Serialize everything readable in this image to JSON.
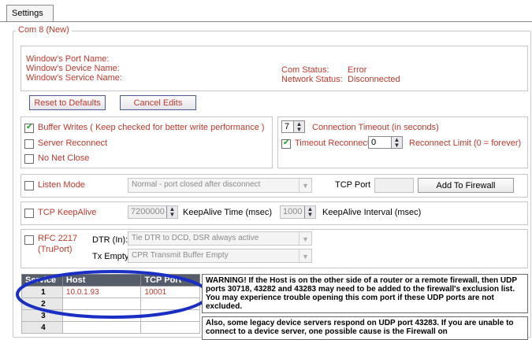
{
  "tabs": {
    "settings": "Settings"
  },
  "group": {
    "title": "Com 8 (New)"
  },
  "info": {
    "port_name_label": "Window's Port Name:",
    "device_name_label": "Window's Device Name:",
    "service_name_label": "Window's Service Name:",
    "com_status_label": "Com Status:",
    "com_status_value": "Error",
    "network_status_label": "Network Status:",
    "network_status_value": "Disconnected"
  },
  "buttons": {
    "reset": "Reset to Defaults",
    "cancel": "Cancel Edits",
    "add_firewall": "Add To Firewall"
  },
  "options": {
    "buffer_writes": "Buffer Writes   ( Keep checked for better write performance )",
    "server_reconnect": "Server Reconnect",
    "no_net_close": "No Net Close",
    "buffer_writes_checked": true,
    "server_reconnect_checked": false,
    "no_net_close_checked": false
  },
  "timeout": {
    "connection_value": "7",
    "connection_label": "Connection Timeout (in seconds)",
    "reconnect_label": "Timeout Reconnect",
    "reconnect_checked": true,
    "reconnect_limit_value": "0",
    "reconnect_limit_label": "Reconnect Limit (0 = forever)"
  },
  "listen": {
    "label": "Listen Mode",
    "checked": false,
    "mode_value": "Normal - port closed after disconnect",
    "tcp_port_label": "TCP Port",
    "tcp_port_value": ""
  },
  "keepalive": {
    "label": "TCP KeepAlive",
    "checked": false,
    "time_value": "7200000",
    "time_label": "KeepAlive Time (msec)",
    "interval_value": "1000",
    "interval_label": "KeepAlive Interval (msec)"
  },
  "rfc": {
    "label_line1": "RFC 2217",
    "label_line2": "(TruPort)",
    "checked": false,
    "dtr_label": "DTR (In):",
    "dtr_value": "Tie DTR to DCD, DSR always active",
    "tx_label": "Tx Empty:",
    "tx_value": "CPR Transmit Buffer Empty"
  },
  "table": {
    "headers": [
      "Service",
      "Host",
      "TCP Port"
    ],
    "rows": [
      {
        "num": "1",
        "host": "10.0.1.93",
        "port": "10001"
      },
      {
        "num": "2",
        "host": "",
        "port": ""
      },
      {
        "num": "3",
        "host": "",
        "port": ""
      },
      {
        "num": "4",
        "host": "",
        "port": ""
      }
    ]
  },
  "warnings": {
    "firewall": "WARNING!  If the Host is on the other side of a router or a remote firewall, then UDP ports 30718, 43282 and 43283 may need to be added to the firewall's exclusion list.  You may experience trouble opening this com port if these UDP ports are not excluded.",
    "legacy": "Also, some legacy device servers respond on UDP port 43283.  If you are unable to connect to a device server, one possible cause is the Firewall on"
  },
  "colors": {
    "accent": "#c0392b",
    "highlight_circle": "#1a2fc4"
  }
}
